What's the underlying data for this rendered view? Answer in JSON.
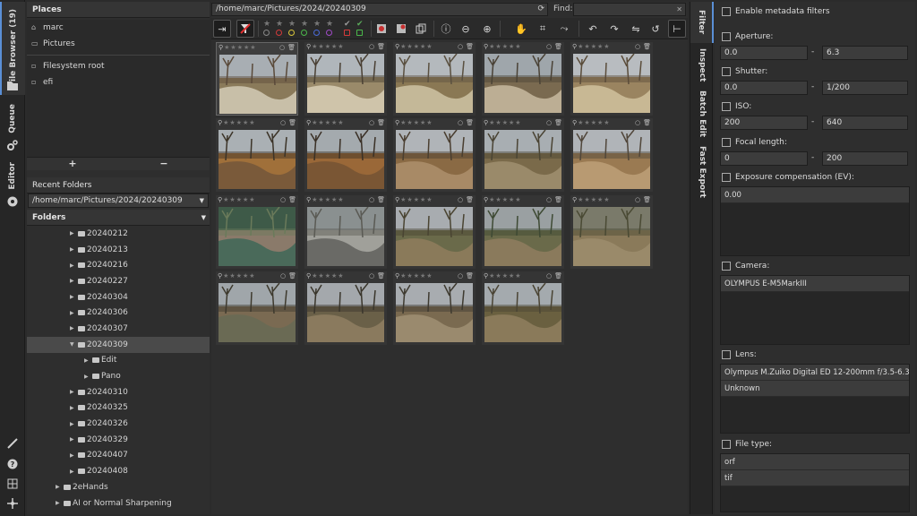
{
  "left_tabs": {
    "file_browser": "File Browser (19)",
    "queue": "Queue",
    "editor": "Editor"
  },
  "places": {
    "title": "Places",
    "items": [
      {
        "label": "marc",
        "icon": "home-icon"
      },
      {
        "label": "Pictures",
        "icon": "folder-icon"
      },
      {
        "label": "Filesystem root",
        "icon": "drive-icon"
      },
      {
        "label": "efi",
        "icon": "drive-icon"
      }
    ],
    "add_label": "+",
    "remove_label": "−"
  },
  "recent_folders": {
    "title": "Recent Folders",
    "selected": "/home/marc/Pictures/2024/20240309"
  },
  "folders": {
    "title": "Folders",
    "rows": [
      {
        "label": "20240212",
        "indent": 2,
        "state": "collapsed"
      },
      {
        "label": "20240213",
        "indent": 2,
        "state": "collapsed"
      },
      {
        "label": "20240216",
        "indent": 2,
        "state": "collapsed"
      },
      {
        "label": "20240227",
        "indent": 2,
        "state": "collapsed"
      },
      {
        "label": "20240304",
        "indent": 2,
        "state": "collapsed"
      },
      {
        "label": "20240306",
        "indent": 2,
        "state": "collapsed"
      },
      {
        "label": "20240307",
        "indent": 2,
        "state": "collapsed"
      },
      {
        "label": "20240309",
        "indent": 2,
        "state": "expanded",
        "selected": true
      },
      {
        "label": "Edit",
        "indent": 3,
        "state": "collapsed"
      },
      {
        "label": "Pano",
        "indent": 3,
        "state": "collapsed"
      },
      {
        "label": "20240310",
        "indent": 2,
        "state": "collapsed"
      },
      {
        "label": "20240325",
        "indent": 2,
        "state": "collapsed"
      },
      {
        "label": "20240326",
        "indent": 2,
        "state": "collapsed"
      },
      {
        "label": "20240329",
        "indent": 2,
        "state": "collapsed"
      },
      {
        "label": "20240407",
        "indent": 2,
        "state": "collapsed"
      },
      {
        "label": "20240408",
        "indent": 2,
        "state": "collapsed"
      },
      {
        "label": "2eHands",
        "indent": 1,
        "state": "collapsed"
      },
      {
        "label": "AI or Normal Sharpening",
        "indent": 1,
        "state": "collapsed"
      }
    ]
  },
  "browser": {
    "path": "/home/marc/Pictures/2024/20240309",
    "find_label": "Find:",
    "find_value": "",
    "thumb_count": 19
  },
  "right_tabs": {
    "filter": "Filter",
    "inspect": "Inspect",
    "batch_edit": "Batch Edit",
    "fast_export": "Fast Export"
  },
  "filter": {
    "enable_label": "Enable metadata filters",
    "aperture": {
      "label": "Aperture:",
      "from": "0.0",
      "to": "6.3"
    },
    "shutter": {
      "label": "Shutter:",
      "from": "0.0",
      "to": "1/200"
    },
    "iso": {
      "label": "ISO:",
      "from": "200",
      "to": "640"
    },
    "focal": {
      "label": "Focal length:",
      "from": "0",
      "to": "200"
    },
    "exposure": {
      "label": "Exposure compensation (EV):",
      "items": [
        "0.00"
      ]
    },
    "camera": {
      "label": "Camera:",
      "items": [
        "OLYMPUS E-M5MarkIII"
      ]
    },
    "lens": {
      "label": "Lens:",
      "items": [
        "Olympus M.Zuiko Digital ED 12-200mm f/3.5-6.3",
        "Unknown"
      ]
    },
    "file_type": {
      "label": "File type:",
      "items": [
        "orf",
        "tif"
      ]
    },
    "range_dash": "-"
  },
  "colors": {
    "accent": "#5a8fd6",
    "label_red": "#d43a3a",
    "label_yellow": "#d8c43a",
    "label_green": "#4ab84a",
    "label_blue": "#4a6ad8",
    "label_purple": "#a04ac8"
  }
}
